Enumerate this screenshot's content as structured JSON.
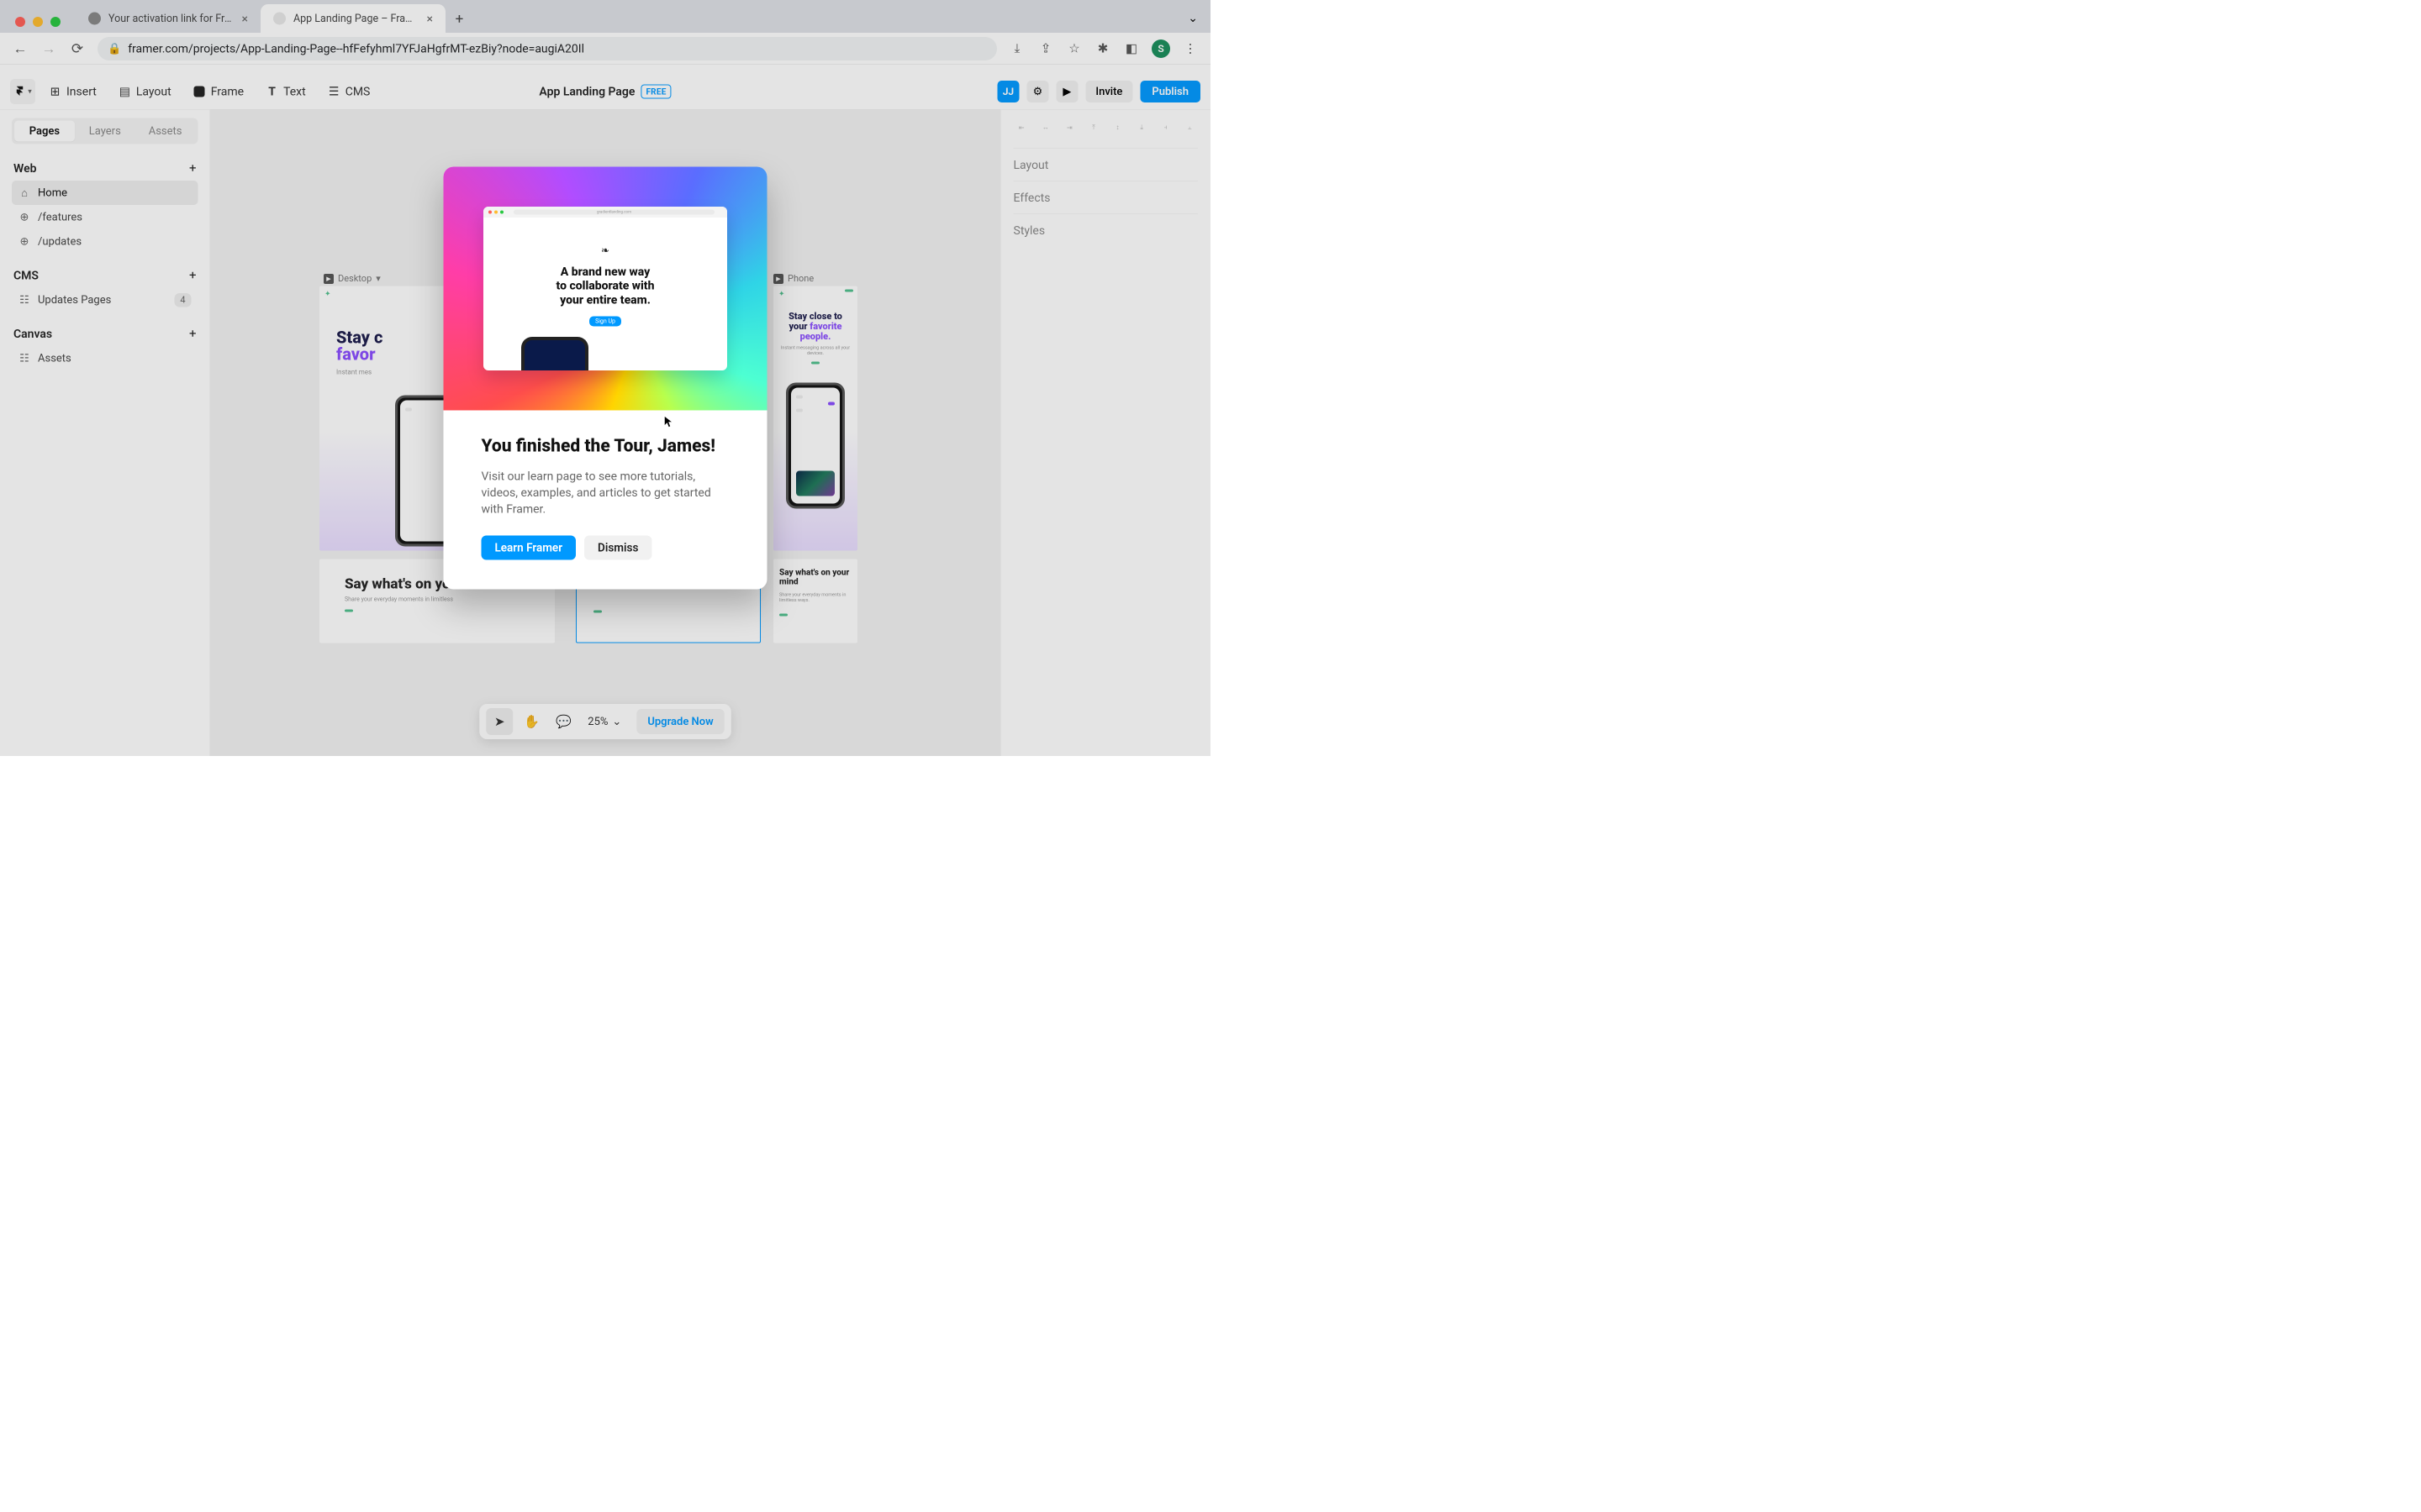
{
  "browser": {
    "tabs": [
      {
        "title": "Your activation link for Framer.",
        "active": false
      },
      {
        "title": "App Landing Page – Framer",
        "active": true
      }
    ],
    "url": "framer.com/projects/App-Landing-Page--hfFefyhml7YFJaHgfrMT-ezBiy?node=augiA20Il",
    "profile_initial": "S"
  },
  "toolbar": {
    "insert": "Insert",
    "layout": "Layout",
    "frame": "Frame",
    "text": "Text",
    "cms": "CMS",
    "project_title": "App Landing Page",
    "free_badge": "FREE",
    "avatar": "JJ",
    "invite": "Invite",
    "publish": "Publish"
  },
  "sidebar": {
    "tabs": [
      "Pages",
      "Layers",
      "Assets"
    ],
    "active_tab": "Pages",
    "sections": {
      "web": {
        "title": "Web",
        "items": [
          {
            "label": "Home",
            "icon": "home-icon",
            "active": true
          },
          {
            "label": "/features",
            "icon": "globe-icon"
          },
          {
            "label": "/updates",
            "icon": "globe-icon"
          }
        ]
      },
      "cms": {
        "title": "CMS",
        "items": [
          {
            "label": "Updates Pages",
            "icon": "stack-icon",
            "badge": "4"
          }
        ]
      },
      "canvas": {
        "title": "Canvas",
        "items": [
          {
            "label": "Assets",
            "icon": "stack-icon"
          }
        ]
      }
    }
  },
  "right_panel": {
    "sections": [
      "Layout",
      "Effects",
      "Styles"
    ]
  },
  "canvas": {
    "frames": [
      {
        "name": "Desktop",
        "headline_line1": "Stay c",
        "headline_favorite": "favor",
        "sub": "Instant mes",
        "say_title": "Say what's on you",
        "say_sub": "Share your everyday moments in limitless"
      },
      {
        "name": "Phone",
        "headline_line1": "Stay close to",
        "headline_line2": "your ",
        "headline_favorite": "favorite",
        "headline_line3": "people.",
        "sub": "Instant messaging across all your devices.",
        "say_title": "Say what's on your mind",
        "say_sub": "Share your everyday moments in limitless ways."
      }
    ]
  },
  "float_bar": {
    "zoom": "25%",
    "upgrade": "Upgrade Now"
  },
  "modal": {
    "hero_url": "gradientlanding.com",
    "hero_headline_l1": "A brand new way",
    "hero_headline_l2": "to collaborate with",
    "hero_headline_l3": "your entire team.",
    "hero_cta": "Sign Up",
    "title": "You finished the Tour, James!",
    "text": "Visit our learn page to see more tutorials, videos, examples, and articles to get started with Framer.",
    "primary": "Learn Framer",
    "secondary": "Dismiss"
  }
}
